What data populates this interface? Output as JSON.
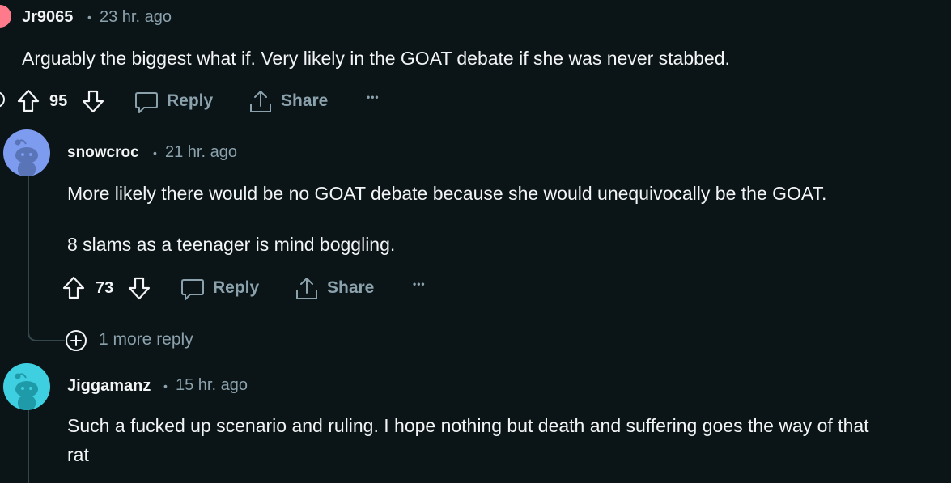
{
  "comments": [
    {
      "username": "Jr9065",
      "time": "23 hr. ago",
      "body": [
        "Arguably the biggest what if. Very likely in the GOAT debate if she was never stabbed."
      ],
      "score": "95",
      "avatar_color": "#ff7b8c"
    },
    {
      "username": "snowcroc",
      "time": "21 hr. ago",
      "body": [
        "More likely there would be no GOAT debate because she would unequivocally be the GOAT.",
        "8 slams as a teenager is mind boggling."
      ],
      "score": "73",
      "avatar_color": "#7d9bef",
      "more_replies": "1 more reply"
    },
    {
      "username": "Jiggamanz",
      "time": "15 hr. ago",
      "body": [
        "Such a fucked up scenario and ruling. I hope nothing but death and suffering goes the way of that",
        "rat"
      ],
      "avatar_color": "#3ed0e0"
    }
  ],
  "actions": {
    "reply": "Reply",
    "share": "Share",
    "overflow": "•••",
    "separator": "•"
  },
  "icons": {
    "upvote": "arrow-up-outline-icon",
    "downvote": "arrow-down-outline-icon",
    "reply": "speech-bubble-icon",
    "share": "share-upload-icon",
    "more_replies": "plus-circle-icon",
    "avatar": "snoo-robot-icon"
  },
  "colors": {
    "background": "#0b1416",
    "text": "#f2f4f5",
    "muted": "#8ba2ad",
    "thread_line": "#33464c"
  }
}
